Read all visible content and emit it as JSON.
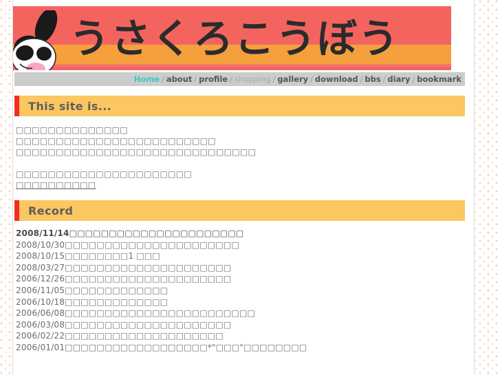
{
  "site": {
    "logo_text": "うさくろこうぼう",
    "mascot_alt": "panda-mascot"
  },
  "nav": {
    "items": [
      {
        "label": "Home",
        "style": "home"
      },
      {
        "label": "about",
        "style": "normal"
      },
      {
        "label": "profile",
        "style": "normal"
      },
      {
        "label": "shopping",
        "style": "dim"
      },
      {
        "label": "gallery",
        "style": "normal"
      },
      {
        "label": "download",
        "style": "normal"
      },
      {
        "label": "bbs",
        "style": "normal"
      },
      {
        "label": "diary",
        "style": "normal"
      },
      {
        "label": "bookmark",
        "style": "normal"
      }
    ],
    "separator": "/"
  },
  "corner_mark": "□",
  "sections": [
    {
      "id": "this-site-is",
      "title": "This site is...",
      "paragraphs": [
        "□□□□□□□□□□□□□□",
        "□□□□□□□□□□□□□□□□□□□□□□□□□",
        "□□□□□□□□□□□□□□□□□□□□□□□□□□□□□□",
        "",
        "□□□□□□□□□□□□□□□□□□□□□□",
        "□□□□□□□□□□"
      ],
      "link_line_index": 5
    },
    {
      "id": "record",
      "title": "Record",
      "records": [
        {
          "date": "2008/11/14",
          "text": "□□□□□□□□□□□□□□□□□□□□□□",
          "bold": true
        },
        {
          "date": "2008/10/30",
          "text": "□□□□□□□□□□□□□□□□□□□□□□",
          "bold": false
        },
        {
          "date": "2008/10/15",
          "text": "□□□□□□□□1 □□□",
          "bold": false
        },
        {
          "date": "2008/03/27",
          "text": "□□□□□□□□□□□□□□□□□□□□□",
          "bold": false
        },
        {
          "date": "2006/12/26",
          "text": "□□□□□□□□□□□□□□□□□□□□□",
          "bold": false
        },
        {
          "date": "2006/11/05",
          "text": "□□□□□□□□□□□□□",
          "bold": false
        },
        {
          "date": "2006/10/18",
          "text": "□□□□□□□□□□□□□",
          "bold": false
        },
        {
          "date": "2006/06/08",
          "text": "□□□□□□□□□□□□□□□□□□□□□□□□",
          "bold": false
        },
        {
          "date": "2006/03/08",
          "text": "□□□□□□□□□□□□□□□□□□□□□",
          "bold": false
        },
        {
          "date": "2006/02/22",
          "text": "□□□□□□□□□□□□□□□□□□□□",
          "bold": false
        },
        {
          "date": "2006/01/01",
          "text": "□□□□□□□□□□□□□□□□□□*\"□□□\"□□□□□□□□",
          "bold": false
        }
      ]
    }
  ],
  "colors": {
    "banner_red": "#f4645f",
    "banner_orange": "#f5a03c",
    "heading_bg": "#fcc660",
    "heading_accent": "#f42b23",
    "nav_bg": "#cccccc",
    "home_link": "#3cc8c0",
    "text_gray": "#6c6c6c",
    "page_bg_dot": "#f7c9a0"
  }
}
